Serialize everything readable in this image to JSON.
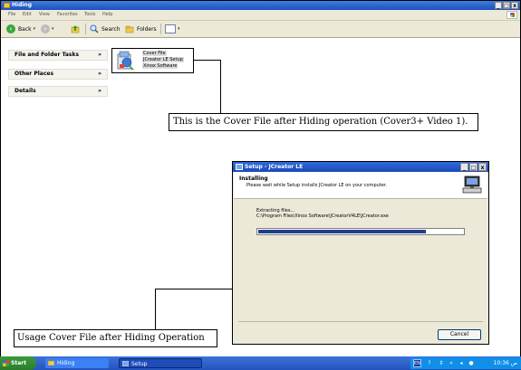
{
  "window": {
    "title": "Hiding",
    "controls": {
      "minimize": "_",
      "maximize": "□",
      "close": "x"
    }
  },
  "menu": [
    "File",
    "Edit",
    "View",
    "Favorites",
    "Tools",
    "Help"
  ],
  "toolbar": {
    "back_label": "Back",
    "search_label": "Search",
    "folders_label": "Folders"
  },
  "left_pane": {
    "sections": [
      {
        "label": "File and Folder Tasks",
        "chevron": "»"
      },
      {
        "label": "Other Places",
        "chevron": "»"
      },
      {
        "label": "Details",
        "chevron": "»"
      }
    ]
  },
  "cover_file": {
    "lines": [
      "Cover File",
      "JCreator LE Setup",
      "Xinox Software"
    ],
    "icon": "installer-file-icon"
  },
  "annotations": {
    "top": "This is the Cover File after Hiding operation (Cover3+ Video 1).",
    "bottom": "Usage Cover File after Hiding Operation"
  },
  "dialog": {
    "title": "Setup - JCreator LE",
    "controls": {
      "minimize": "_",
      "maximize": "□",
      "close": "x"
    },
    "heading": "Installing",
    "subheading": "Please wait while Setup installs JCreator LE on your computer.",
    "status_line": "Extracting files...",
    "path_line": "C:\\Program Files\\Xinox Software\\JCreatorV4LE\\JCreator.exe",
    "progress": 0.82,
    "cancel_label": "Cancel"
  },
  "taskbar": {
    "start_label": "Start",
    "tasks": [
      {
        "label": "Hiding",
        "icon": "folder-icon"
      },
      {
        "label": "Setup",
        "icon": "setup-icon"
      }
    ],
    "tray": {
      "language": "EN",
      "clock": "10:36 ص"
    }
  },
  "colors": {
    "titlebar": "#1d4fbf",
    "taskbar": "#2453bd",
    "progress_fill": "#1f3f8a",
    "start_button": "#2c7d2c"
  }
}
